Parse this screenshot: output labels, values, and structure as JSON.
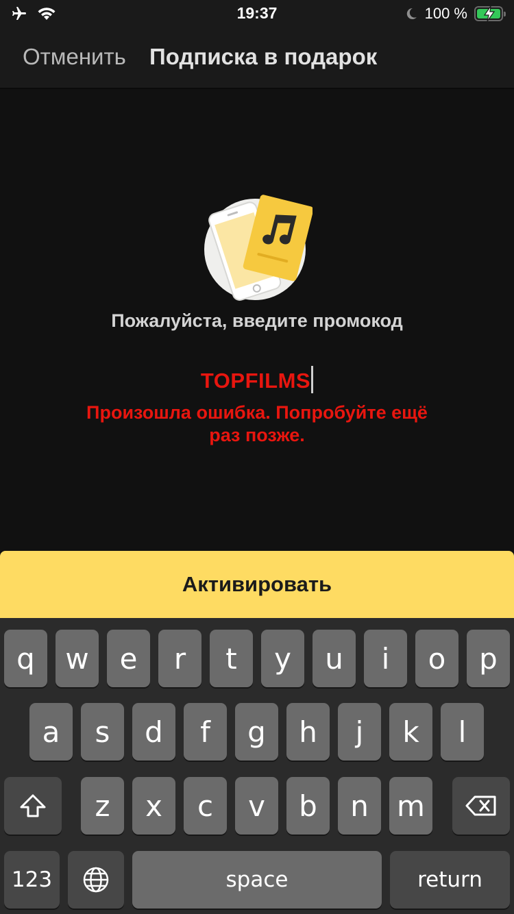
{
  "status_bar": {
    "time": "19:37",
    "battery_percent": "100 %",
    "battery_level": 1.0,
    "icons": [
      "airplane-icon",
      "wifi-icon",
      "moon-icon",
      "battery-charging-icon"
    ]
  },
  "nav": {
    "cancel_label": "Отменить",
    "title": "Подписка в подарок"
  },
  "main": {
    "illustration_icon": "phone-with-music-card-icon",
    "prompt": "Пожалуйста, введите промокод",
    "promo_code_value": "TOPFILMS",
    "error_line1": "Произошла ошибка. Попробуйте ещё",
    "error_line2": "раз позже."
  },
  "activate_button": {
    "label": "Активировать"
  },
  "keyboard": {
    "row1": [
      "q",
      "w",
      "e",
      "r",
      "t",
      "y",
      "u",
      "i",
      "o",
      "p"
    ],
    "row2": [
      "a",
      "s",
      "d",
      "f",
      "g",
      "h",
      "j",
      "k",
      "l"
    ],
    "row3": [
      "z",
      "x",
      "c",
      "v",
      "b",
      "n",
      "m"
    ],
    "numbers_label": "123",
    "space_label": "space",
    "return_label": "return"
  },
  "colors": {
    "accent_yellow": "#fedb62",
    "error_red": "#e8160f",
    "background": "#111111"
  }
}
